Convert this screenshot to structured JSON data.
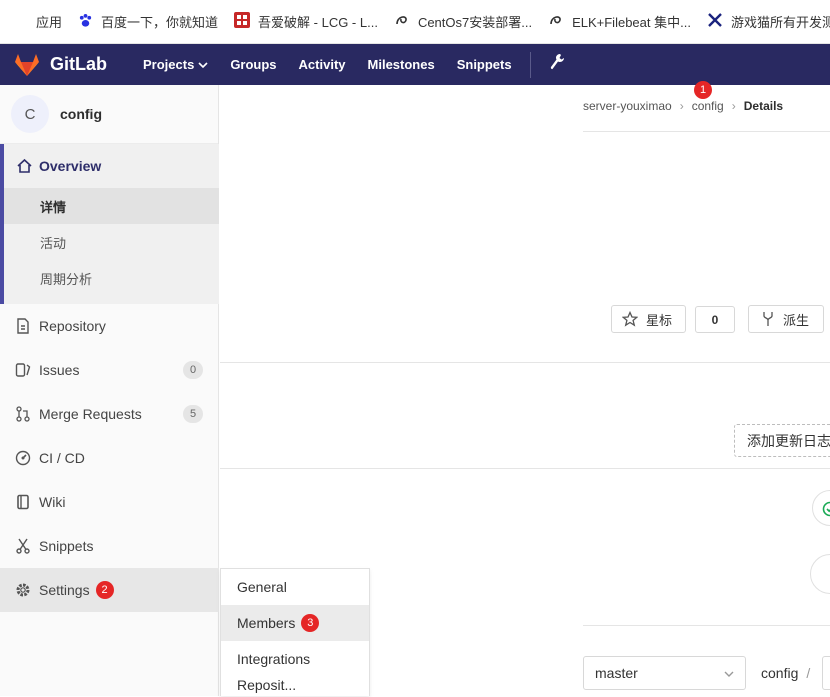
{
  "bookmarks": [
    {
      "label": "应用",
      "icon": "apps-grid-icon"
    },
    {
      "label": "百度一下，你就知道",
      "icon": "baidu-paw-icon"
    },
    {
      "label": "吾爱破解 - LCG - L...",
      "icon": "52pojie-icon"
    },
    {
      "label": "CentOs7安装部署...",
      "icon": "csdn-swirl-icon"
    },
    {
      "label": "ELK+Filebeat 集中...",
      "icon": "csdn-swirl-icon"
    },
    {
      "label": "游戏猫所有开发测...",
      "icon": "crossed-tools-icon"
    }
  ],
  "topnav": {
    "brand": "GitLab",
    "links": [
      "Projects",
      "Groups",
      "Activity",
      "Milestones",
      "Snippets"
    ],
    "bg_color": "#292961"
  },
  "sidebar": {
    "project_avatar": "C",
    "project_name": "config",
    "overview": {
      "label": "Overview",
      "subitems": [
        "详情",
        "活动",
        "周期分析"
      ]
    },
    "items": [
      {
        "label": "Repository",
        "icon": "document-icon"
      },
      {
        "label": "Issues",
        "icon": "issues-icon",
        "count": "0"
      },
      {
        "label": "Merge Requests",
        "icon": "merge-request-icon",
        "count": "5"
      },
      {
        "label": "CI / CD",
        "icon": "rocket-gauge-icon"
      },
      {
        "label": "Wiki",
        "icon": "book-icon"
      },
      {
        "label": "Snippets",
        "icon": "scissors-icon"
      },
      {
        "label": "Settings",
        "icon": "gear-icon"
      }
    ]
  },
  "settings_flyout": [
    "General",
    "Members",
    "Integrations",
    "Reposit..."
  ],
  "markers": {
    "m1": "1",
    "m2": "2",
    "m3": "3"
  },
  "breadcrumb": [
    "server-youximao",
    "config",
    "Details"
  ],
  "actions": {
    "star": "星标",
    "star_count": "0",
    "fork": "派生",
    "changelog": "添加更新日志"
  },
  "branch_select": "master",
  "path_root": "config",
  "path_sep": "/"
}
